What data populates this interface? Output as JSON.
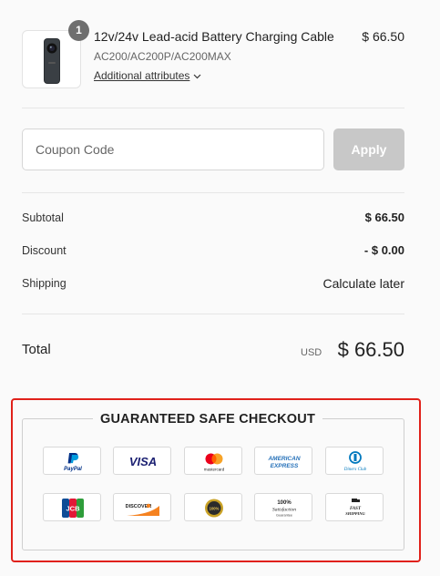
{
  "product": {
    "quantity": "1",
    "name": "12v/24v Lead-acid Battery Charging Cable",
    "variant": "AC200/AC200P/AC200MAX",
    "attributes_link": "Additional attributes",
    "price": "$ 66.50"
  },
  "coupon": {
    "placeholder": "Coupon Code",
    "apply_label": "Apply"
  },
  "summary": {
    "subtotal_label": "Subtotal",
    "subtotal_value": "$ 66.50",
    "discount_label": "Discount",
    "discount_value": "- $ 0.00",
    "shipping_label": "Shipping",
    "shipping_value": "Calculate later"
  },
  "total": {
    "label": "Total",
    "currency": "USD",
    "amount": "$ 66.50"
  },
  "safe_checkout": {
    "title": "GUARANTEED SAFE CHECKOUT",
    "badge_texts": {
      "paypal": "PayPal",
      "visa": "VISA",
      "mastercard": "mastercard",
      "amex_top": "AMERICAN",
      "amex_bottom": "EXPRESS",
      "diners": "Diners Club",
      "jcb": "JCB",
      "discover": "DISCOVER",
      "guarantee": "100%",
      "satisfaction_top": "100%",
      "satisfaction_mid": "Satisfaction",
      "satisfaction_bottom": "Guarantee",
      "shipping_top": "FAST",
      "shipping_bottom": "SHIPPING"
    }
  },
  "colors": {
    "highlight": "#e0211a",
    "apply_bg": "#c8c8c8",
    "visa_blue": "#1a1f71",
    "paypal_blue": "#003087",
    "amex_blue": "#2671b9"
  }
}
